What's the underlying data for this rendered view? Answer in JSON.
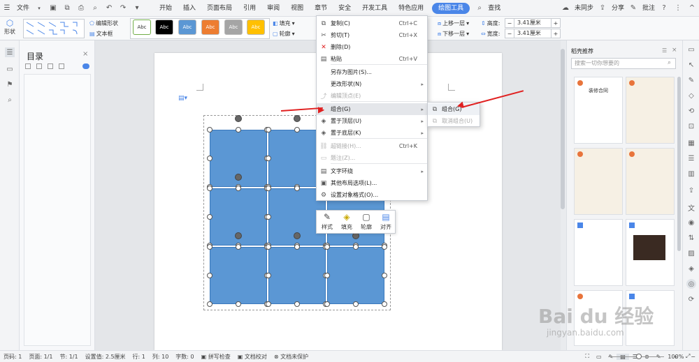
{
  "menubar": {
    "file": "文件",
    "tabs": [
      "开始",
      "插入",
      "页面布局",
      "引用",
      "审阅",
      "视图",
      "章节",
      "安全",
      "开发工具",
      "特色应用",
      "绘图工具"
    ],
    "search": "查找",
    "sync": "未同步",
    "share": "分享",
    "comment": "批注"
  },
  "ribbon": {
    "shape": "形状",
    "edit_shape": "编辑形状",
    "textbox": "文本框",
    "styles": [
      "Abc",
      "Abc",
      "Abc",
      "Abc",
      "Abc",
      "Abc"
    ],
    "style_colors": [
      "#ffffff",
      "#000000",
      "#5b97d4",
      "#ed7d31",
      "#a5a5a5",
      "#ffc000"
    ],
    "fill": "填充",
    "outline": "轮廓",
    "up_layer": "上移一层",
    "down_layer": "下移一层",
    "height_label": "高度:",
    "height_value": "3.41厘米",
    "width_label": "宽度:",
    "width_value": "3.41厘米"
  },
  "toc": {
    "title": "目录"
  },
  "context_menu": {
    "items": [
      {
        "label": "复制(C)",
        "shortcut": "Ctrl+C",
        "icon": "copy-icon"
      },
      {
        "label": "剪切(T)",
        "shortcut": "Ctrl+X",
        "icon": "cut-icon"
      },
      {
        "label": "删除(D)",
        "shortcut": "",
        "icon": "delete-icon"
      },
      {
        "label": "粘贴",
        "shortcut": "Ctrl+V",
        "icon": "paste-icon"
      },
      {
        "label": "另存为图片(S)...",
        "shortcut": "",
        "icon": ""
      },
      {
        "label": "更改形状(N)",
        "shortcut": "",
        "icon": ""
      },
      {
        "label": "编辑顶点(E)",
        "shortcut": "",
        "icon": "edit-points-icon"
      },
      {
        "label": "组合(G)",
        "shortcut": "",
        "icon": ""
      },
      {
        "label": "置于顶层(U)",
        "shortcut": "",
        "icon": "bring-front-icon"
      },
      {
        "label": "置于底层(K)",
        "shortcut": "",
        "icon": "send-back-icon"
      },
      {
        "label": "超链接(H)...",
        "shortcut": "Ctrl+K",
        "icon": "hyperlink-icon"
      },
      {
        "label": "题注(Z)...",
        "shortcut": "",
        "icon": "caption-icon"
      },
      {
        "label": "文字环绕",
        "shortcut": "",
        "icon": "wrap-icon"
      },
      {
        "label": "其他布局选项(L)...",
        "shortcut": "",
        "icon": "layout-icon"
      },
      {
        "label": "设置对象格式(O)...",
        "shortcut": "",
        "icon": "format-icon"
      }
    ],
    "submenu": [
      "组合(G)",
      "取消组合(U)"
    ]
  },
  "mini_toolbar": [
    "样式",
    "填充",
    "轮廓",
    "对齐"
  ],
  "right_panel": {
    "title": "稻壳推荐",
    "search_placeholder": "搜索一切你想要的",
    "thumb_title": "装修合同"
  },
  "status": {
    "page": "页码: 1",
    "pages": "页面: 1/1",
    "section": "节: 1/1",
    "setting": "设置值: 2.5厘米",
    "row": "行: 1",
    "col": "列: 10",
    "words": "字数: 0",
    "spell": "拼写检查",
    "proof": "文档校对",
    "protect": "文档未保护",
    "zoom": "100%"
  },
  "watermark": "Bai du 经验",
  "watermark_url": "jingyan.baidu.com"
}
